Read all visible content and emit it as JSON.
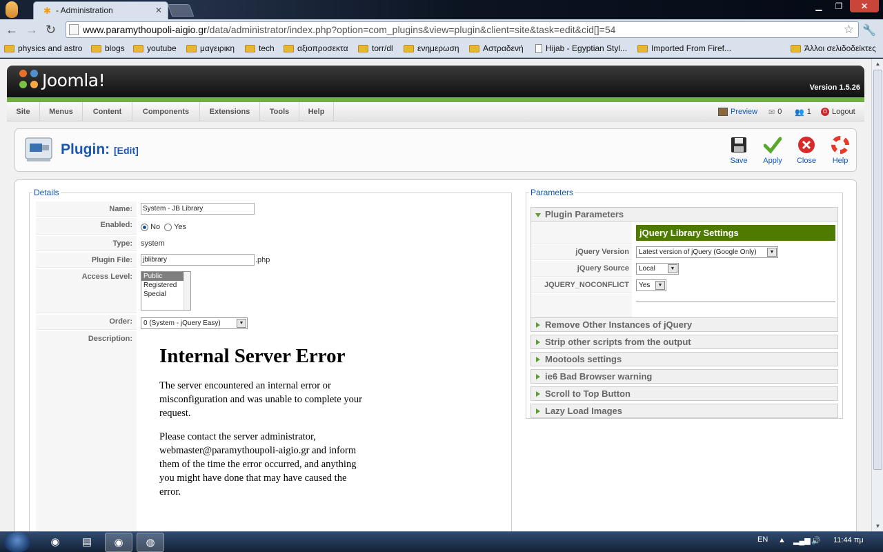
{
  "browser": {
    "tab_title": "- Administration",
    "url_domain": "www.paramythoupoli-aigio.gr",
    "url_path": "/data/administrator/index.php?option=com_plugins&view=plugin&client=site&task=edit&cid[]=54",
    "bookmarks": [
      "physics and astro",
      "blogs",
      "youtube",
      "μαγειρικη",
      "tech",
      "αξιοπροσεκτα",
      "torr/dl",
      "ενημερωση",
      "Αστραδενή",
      "Hijab - Egyptian Styl...",
      "Imported From Firef..."
    ],
    "other_bookmarks": "Άλλοι σελιδοδείκτες"
  },
  "header": {
    "logo_text": "Joomla!",
    "version": "Version 1.5.26"
  },
  "menu": {
    "items": [
      "Site",
      "Menus",
      "Content",
      "Components",
      "Extensions",
      "Tools",
      "Help"
    ],
    "preview": "Preview",
    "messages_count": "0",
    "users_count": "1",
    "logout": "Logout"
  },
  "toolbar": {
    "title": "Plugin:",
    "subtitle": "[Edit]",
    "buttons": [
      "Save",
      "Apply",
      "Close",
      "Help"
    ]
  },
  "details": {
    "legend": "Details",
    "name_label": "Name:",
    "name_value": "System - JB Library",
    "enabled_label": "Enabled:",
    "enabled_no": "No",
    "enabled_yes": "Yes",
    "type_label": "Type:",
    "type_value": "system",
    "file_label": "Plugin File:",
    "file_value": "jblibrary",
    "file_ext": ".php",
    "access_label": "Access Level:",
    "access_options": [
      "Public",
      "Registered",
      "Special"
    ],
    "order_label": "Order:",
    "order_value": "0 (System - jQuery Easy)",
    "description_label": "Description:"
  },
  "error": {
    "heading": "Internal Server Error",
    "para1": "The server encountered an internal error or misconfiguration and was unable to complete your request.",
    "para2": "Please contact the server administrator, webmaster@paramythoupoli-aigio.gr and inform them of the time the error occurred, and anything you might have done that may have caused the error."
  },
  "parameters": {
    "legend": "Parameters",
    "open_section": "Plugin Parameters",
    "settings_header": "jQuery Library Settings",
    "jquery_version_label": "jQuery Version",
    "jquery_version_value": "Latest version of jQuery (Google Only)",
    "jquery_source_label": "jQuery Source",
    "jquery_source_value": "Local",
    "noconflict_label": "JQUERY_NOCONFLICT",
    "noconflict_value": "Yes",
    "sections": [
      "Remove Other Instances of jQuery",
      "Strip other scripts from the output",
      "Mootools settings",
      "ie6 Bad Browser warning",
      "Scroll to Top Button",
      "Lazy Load Images"
    ]
  },
  "taskbar": {
    "lang": "EN",
    "time": "11:44 πμ"
  },
  "colors": {
    "joomla_green": "#6fb13b",
    "link_blue": "#0b55c4",
    "settings_green": "#4e7a00"
  }
}
